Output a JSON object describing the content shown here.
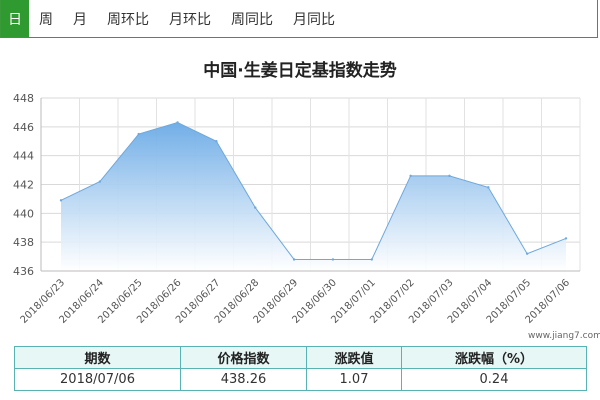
{
  "tabs": [
    {
      "label": "日",
      "active": true
    },
    {
      "label": "周",
      "active": false
    },
    {
      "label": "月",
      "active": false
    },
    {
      "label": "周环比",
      "active": false
    },
    {
      "label": "月环比",
      "active": false
    },
    {
      "label": "周同比",
      "active": false
    },
    {
      "label": "月同比",
      "active": false
    }
  ],
  "colors": {
    "accent": "#2f9a2f",
    "area_top": "#6aaae6",
    "area_bottom": "#ffffff",
    "line": "#6fa8dc",
    "table_border": "#59b3b3",
    "table_header": "#e6f7f5"
  },
  "chart_data": {
    "type": "area",
    "title": "中国·生姜日定基指数走势",
    "categories": [
      "2018/06/23",
      "2018/06/24",
      "2018/06/25",
      "2018/06/26",
      "2018/06/27",
      "2018/06/28",
      "2018/06/29",
      "2018/06/30",
      "2018/07/01",
      "2018/07/02",
      "2018/07/03",
      "2018/07/04",
      "2018/07/05",
      "2018/07/06"
    ],
    "series": [
      {
        "values": [
          440.9,
          442.2,
          445.5,
          446.3,
          445.0,
          440.4,
          436.8,
          436.8,
          436.8,
          442.6,
          442.6,
          441.8,
          437.2,
          438.26
        ]
      }
    ],
    "yticks": [
      436,
      438,
      440,
      442,
      444,
      446,
      448
    ],
    "ylim": [
      436,
      448
    ],
    "grid": true,
    "legend": "none"
  },
  "watermark": "www.jiang7.com",
  "summary": {
    "headers": [
      "期数",
      "价格指数",
      "涨跌值",
      "涨跌幅（%）"
    ],
    "row": [
      "2018/07/06",
      "438.26",
      "1.07",
      "0.24"
    ]
  }
}
